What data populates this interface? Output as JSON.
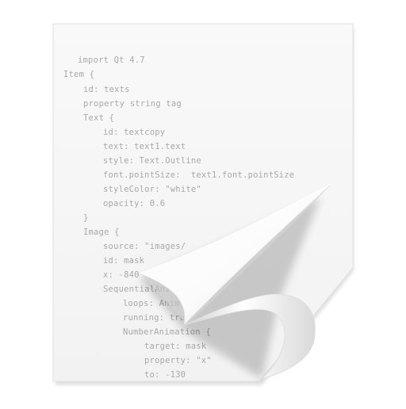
{
  "icon_name": "text-x-qml-file-icon",
  "code_lines": [
    "import Qt 4.7",
    "Item {",
    "id: texts",
    "property string tag",
    "Text {",
    "id: textcopy",
    "text: text1.text",
    "style: Text.Outline",
    "font.pointSize:  text1.font.pointSize",
    "styleColor: \"white\"",
    "opacity: 0.6",
    "}",
    "Image {",
    "source: \"images/",
    "id: mask",
    "x: -840",
    "SequentialAni",
    "loops: Anim",
    "running: tru",
    "NumberAnimation {",
    "target: mask",
    "property: \"x\"",
    "to: -130"
  ],
  "colors": {
    "page": "#fafafa",
    "page_edge": "#e3e3e3",
    "text": "#a9a9a9",
    "curl_light": "#ffffff",
    "curl_shadow": "#bdbdbd"
  }
}
